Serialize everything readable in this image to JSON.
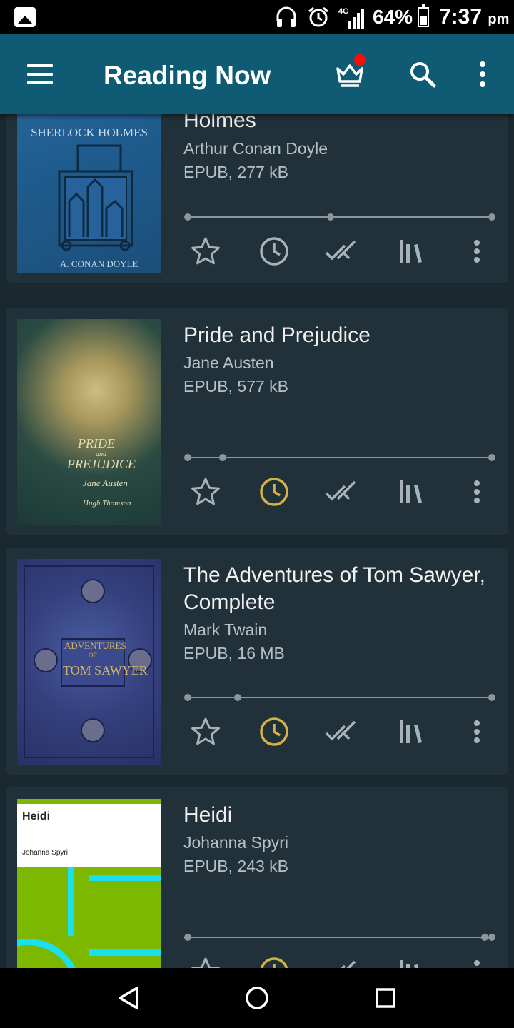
{
  "status_bar": {
    "battery": "64%",
    "time": "7:37",
    "ampm": "pm",
    "network": "4G"
  },
  "app_bar": {
    "title": "Reading Now",
    "icons": [
      "menu-icon",
      "crown-icon",
      "search-icon",
      "more-vert-icon"
    ],
    "notification_color": "#ff0b0b"
  },
  "books": [
    {
      "title": "Holmes",
      "author": "Arthur Conan Doyle",
      "meta": "EPUB, 277 kB",
      "cover_text": [
        "SHERLOCK HOLMES",
        "A. CONAN DOYLE"
      ],
      "progress": 0.47,
      "recent": false
    },
    {
      "title": "Pride and Prejudice",
      "author": "Jane Austen",
      "meta": "EPUB, 577 kB",
      "cover_text": [
        "PRIDE",
        "and",
        "PREJUDICE",
        "Jane Austen",
        "Hugh Thomson"
      ],
      "progress": 0.12,
      "recent": true
    },
    {
      "title": "The Adventures of Tom Sawyer, Complete",
      "author": "Mark Twain",
      "meta": "EPUB, 16 MB",
      "cover_text": [
        "ADVENTURES",
        "OF",
        "TOM SAWYER"
      ],
      "progress": 0.17,
      "recent": true
    },
    {
      "title": "Heidi",
      "author": "Johanna Spyri",
      "meta": "EPUB, 243 kB",
      "cover_text": [
        "Heidi",
        "Johanna Spyri"
      ],
      "progress": 0.98,
      "recent": true
    }
  ],
  "actions": [
    "favorite-star-icon",
    "recent-clock-icon",
    "finished-check-icon",
    "collections-icon",
    "more-vert-icon"
  ],
  "colors": {
    "appbar": "#0e5b73",
    "background": "#1a282f",
    "card": "#213139",
    "accent": "#d4b24a",
    "icon": "#a9b3b7"
  },
  "nav_bar": [
    "back-icon",
    "home-icon",
    "recents-icon"
  ]
}
